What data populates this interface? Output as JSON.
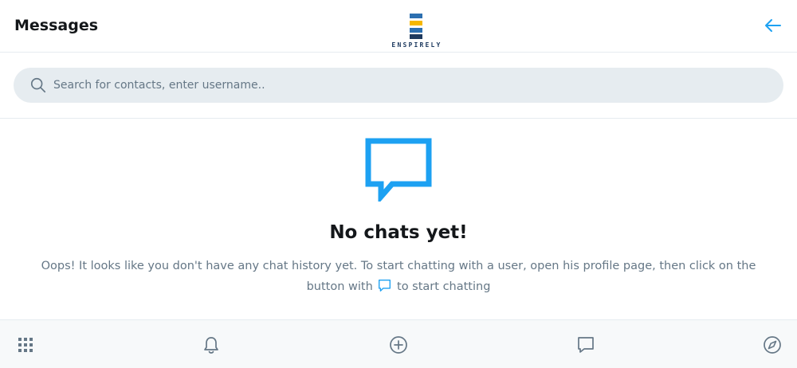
{
  "header": {
    "title": "Messages",
    "logo_text": "ENSPIRELY",
    "back_icon": "arrow-left-icon"
  },
  "search": {
    "placeholder": "Search for contacts, enter username..",
    "value": "",
    "icon": "search-icon"
  },
  "empty_state": {
    "icon": "chat-bubble-icon",
    "title": "No chats yet!",
    "text_before": "Oops! It looks like you don't have any chat history yet. To start chatting with a user, open his profile page, then click on the button with",
    "text_after": "to start chatting"
  },
  "bottom_nav": {
    "items": [
      {
        "icon": "apps-grid-icon"
      },
      {
        "icon": "bell-icon"
      },
      {
        "icon": "plus-circle-icon"
      },
      {
        "icon": "chat-icon"
      },
      {
        "icon": "compass-icon"
      }
    ]
  },
  "colors": {
    "accent": "#1da1f2",
    "text": "#14171a",
    "muted": "#657786",
    "border": "#e6ecf0",
    "logo_yellow": "#f5b700",
    "logo_blue": "#2c6fb0",
    "logo_navy": "#1e3a5f"
  }
}
